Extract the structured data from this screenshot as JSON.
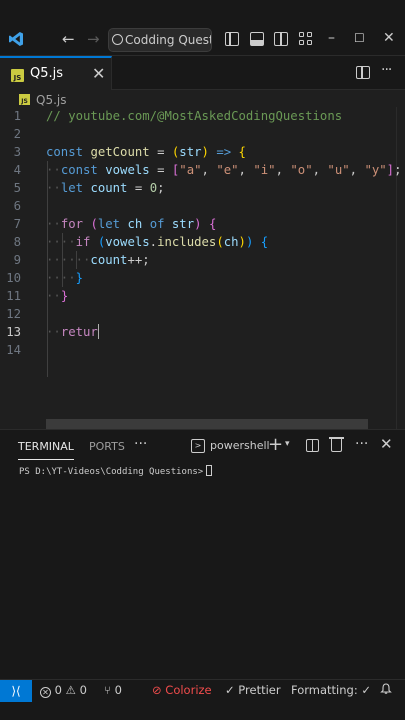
{
  "titlebar": {
    "search_text": "Codding Questio",
    "nav_back": "←",
    "nav_forward": "→",
    "window_controls": [
      "–",
      "☐",
      "✕"
    ]
  },
  "tab": {
    "file_badge": "JS",
    "label": "Q5.js",
    "close": "✕"
  },
  "breadcrumb": {
    "badge": "JS",
    "label": "Q5.js"
  },
  "editor": {
    "active_line": 13,
    "lines": [
      {
        "n": "1",
        "tokens": [
          {
            "t": "// youtube.com/@MostAskedCodingQuestions",
            "c": "cmt"
          }
        ]
      },
      {
        "n": "2",
        "tokens": []
      },
      {
        "n": "3",
        "tokens": [
          {
            "t": "const",
            "c": "kw"
          },
          {
            "t": " "
          },
          {
            "t": "getCount",
            "c": "fn"
          },
          {
            "t": " = "
          },
          {
            "t": "(",
            "c": "br1"
          },
          {
            "t": "str",
            "c": "var"
          },
          {
            "t": ")",
            "c": "br1"
          },
          {
            "t": " "
          },
          {
            "t": "=>",
            "c": "kw"
          },
          {
            "t": " "
          },
          {
            "t": "{",
            "c": "br1"
          }
        ]
      },
      {
        "n": "4",
        "tokens": [
          {
            "t": "··",
            "c": "dot"
          },
          {
            "t": "const",
            "c": "kw"
          },
          {
            "t": " "
          },
          {
            "t": "vowels",
            "c": "var"
          },
          {
            "t": " = "
          },
          {
            "t": "[",
            "c": "br2"
          },
          {
            "t": "\"a\"",
            "c": "str"
          },
          {
            "t": ", "
          },
          {
            "t": "\"e\"",
            "c": "str"
          },
          {
            "t": ", "
          },
          {
            "t": "\"i\"",
            "c": "str"
          },
          {
            "t": ", "
          },
          {
            "t": "\"o\"",
            "c": "str"
          },
          {
            "t": ", "
          },
          {
            "t": "\"u\"",
            "c": "str"
          },
          {
            "t": ", "
          },
          {
            "t": "\"y\"",
            "c": "str"
          },
          {
            "t": "]",
            "c": "br2"
          },
          {
            "t": ";"
          }
        ]
      },
      {
        "n": "5",
        "tokens": [
          {
            "t": "··",
            "c": "dot"
          },
          {
            "t": "let",
            "c": "kw"
          },
          {
            "t": " "
          },
          {
            "t": "count",
            "c": "var"
          },
          {
            "t": " = "
          },
          {
            "t": "0",
            "c": "num"
          },
          {
            "t": ";"
          }
        ]
      },
      {
        "n": "6",
        "tokens": []
      },
      {
        "n": "7",
        "tokens": [
          {
            "t": "··",
            "c": "dot"
          },
          {
            "t": "for",
            "c": "ctl"
          },
          {
            "t": " "
          },
          {
            "t": "(",
            "c": "br2"
          },
          {
            "t": "let",
            "c": "kw"
          },
          {
            "t": " "
          },
          {
            "t": "ch",
            "c": "var"
          },
          {
            "t": " "
          },
          {
            "t": "of",
            "c": "kw"
          },
          {
            "t": " "
          },
          {
            "t": "str",
            "c": "var"
          },
          {
            "t": ")",
            "c": "br2"
          },
          {
            "t": " "
          },
          {
            "t": "{",
            "c": "br2"
          }
        ]
      },
      {
        "n": "8",
        "tokens": [
          {
            "t": "····",
            "c": "dot"
          },
          {
            "t": "if",
            "c": "ctl"
          },
          {
            "t": " "
          },
          {
            "t": "(",
            "c": "br3"
          },
          {
            "t": "vowels",
            "c": "var"
          },
          {
            "t": "."
          },
          {
            "t": "includes",
            "c": "fn"
          },
          {
            "t": "(",
            "c": "br1"
          },
          {
            "t": "ch",
            "c": "var"
          },
          {
            "t": ")",
            "c": "br1"
          },
          {
            "t": ")",
            "c": "br3"
          },
          {
            "t": " "
          },
          {
            "t": "{",
            "c": "br3"
          }
        ]
      },
      {
        "n": "9",
        "tokens": [
          {
            "t": "······",
            "c": "dot"
          },
          {
            "t": "count",
            "c": "var"
          },
          {
            "t": "++;"
          }
        ]
      },
      {
        "n": "10",
        "tokens": [
          {
            "t": "····",
            "c": "dot"
          },
          {
            "t": "}",
            "c": "br3"
          }
        ]
      },
      {
        "n": "11",
        "tokens": [
          {
            "t": "··",
            "c": "dot"
          },
          {
            "t": "}",
            "c": "br2"
          }
        ]
      },
      {
        "n": "12",
        "tokens": []
      },
      {
        "n": "13",
        "tokens": [
          {
            "t": "··",
            "c": "dot"
          },
          {
            "t": "retur",
            "c": "ctl"
          }
        ]
      },
      {
        "n": "14",
        "tokens": []
      }
    ]
  },
  "panel": {
    "tabs": [
      "TERMINAL",
      "PORTS"
    ],
    "more": "···",
    "terminal_name": "powershell",
    "plus": "+",
    "chevron": "⌄",
    "dots": "···",
    "close": "✕",
    "terminal_line": "PS D:\\YT-Videos\\Codding Questions>",
    "term_icon_glyph": ">"
  },
  "status": {
    "remote": "⟩⟨",
    "errors": "0",
    "warnings": "0",
    "ports": "0",
    "colorize": "Colorize",
    "prettier": "Prettier",
    "formatting": "Formatting: ✓",
    "error_glyph": "✕",
    "warning_glyph": "⚠",
    "ports_glyph": "⑂",
    "colorize_glyph": "⊘",
    "prettier_glyph": "✓"
  },
  "colors": {
    "accent": "#0078d4",
    "editor_bg": "#1f1f1f",
    "chrome_bg": "#181818"
  }
}
